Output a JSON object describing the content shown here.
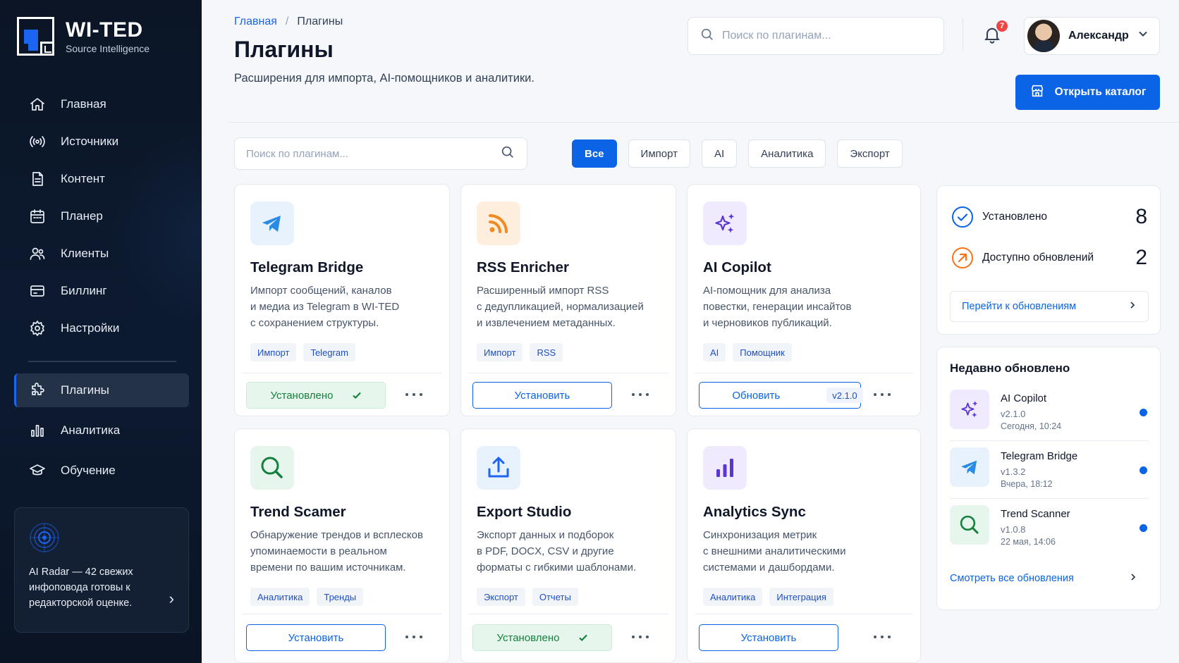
{
  "brand": {
    "title": "WI-TED",
    "subtitle": "Source Intelligence",
    "accent": "#1c64f2"
  },
  "sidebar": {
    "items": [
      {
        "label": "Главная",
        "icon": "home-icon"
      },
      {
        "label": "Источники",
        "icon": "broadcast-icon"
      },
      {
        "label": "Контент",
        "icon": "document-icon"
      },
      {
        "label": "Планер",
        "icon": "calendar-icon"
      },
      {
        "label": "Клиенты",
        "icon": "users-icon"
      },
      {
        "label": "Биллинг",
        "icon": "card-icon"
      },
      {
        "label": "Настройки",
        "icon": "gear-icon"
      }
    ],
    "items2": [
      {
        "label": "Плагины",
        "icon": "puzzle-icon",
        "active": true
      },
      {
        "label": "Аналитика",
        "icon": "bar-chart-icon"
      },
      {
        "label": "Обучение",
        "icon": "graduation-cap-icon"
      }
    ],
    "radar": {
      "text": "AI Radar — 42 свежих инфоповода готовы к редакторской оценке."
    }
  },
  "header": {
    "breadcrumb": {
      "home": "Главная",
      "separator": "/",
      "current": "Плагины"
    },
    "title": "Плагины",
    "subtitle": "Расширения для импорта, AI-помощников и аналитики.",
    "search_placeholder": "Поиск по плагинам...",
    "notifications": "7",
    "user_name": "Александр",
    "catalog_button": "Открыть каталог"
  },
  "filters": {
    "search_placeholder": "Поиск по плагинам...",
    "chips": [
      "Все",
      "Импорт",
      "AI",
      "Аналитика",
      "Экспорт"
    ],
    "active": "Все"
  },
  "plugins": [
    {
      "name": "Telegram Bridge",
      "icon": "telegram-icon",
      "desc": [
        "Импорт сообщений, каналов",
        "и медиа из Telegram в WI-TED",
        "с сохранением структуры."
      ],
      "tags": [
        "Импорт",
        "Telegram"
      ],
      "action": "installed",
      "action_label": "Установлено"
    },
    {
      "name": "RSS Enricher",
      "icon": "rss-icon",
      "desc": [
        "Расширенный импорт RSS",
        "с дедупликацией, нормализацией",
        "и извлечением метаданных."
      ],
      "tags": [
        "Импорт",
        "RSS"
      ],
      "action": "install",
      "action_label": "Установить"
    },
    {
      "name": "AI Copilot",
      "icon": "sparkles-icon",
      "desc": [
        "AI-помощник для анализа",
        "повестки, генерации инсайтов",
        "и черновиков публикаций."
      ],
      "tags": [
        "AI",
        "Помощник"
      ],
      "action": "update",
      "action_label": "Обновить",
      "version": "v2.1.0"
    },
    {
      "name": "Trend Scamer",
      "icon": "search-icon",
      "desc": [
        "Обнаружение трендов и всплесков",
        "упоминаемости в реальном",
        "времени по вашим источникам."
      ],
      "tags": [
        "Аналитика",
        "Тренды"
      ],
      "action": "install",
      "action_label": "Установить"
    },
    {
      "name": "Export Studio",
      "icon": "upload-icon",
      "desc": [
        "Экспорт данных и подборок",
        "в PDF, DOCX, CSV и другие",
        "форматы с гибкими шаблонами."
      ],
      "tags": [
        "Экспорт",
        "Отчеты"
      ],
      "action": "installed",
      "action_label": "Установлено"
    },
    {
      "name": "Analytics Sync",
      "icon": "bar-chart-icon",
      "desc": [
        "Синхронизация метрик",
        "с внешними аналитическими",
        "системами и дашбордами."
      ],
      "tags": [
        "Аналитика",
        "Интеграция"
      ],
      "action": "install",
      "action_label": "Установить"
    }
  ],
  "stats": {
    "installed_label": "Установлено",
    "installed_count": "8",
    "updates_label": "Доступно обновлений",
    "updates_count": "2",
    "link": "Перейти к обновлениям"
  },
  "recent": {
    "title": "Недавно обновлено",
    "items": [
      {
        "name": "AI Copilot",
        "version": "v2.1.0",
        "date": "Сегодня, 10:24",
        "icon": "sparkles-icon"
      },
      {
        "name": "Telegram Bridge",
        "version": "v1.3.2",
        "date": "Вчера, 18:12",
        "icon": "telegram-icon"
      },
      {
        "name": "Trend Scanner",
        "version": "v1.0.8",
        "date": "22 мая, 14:06",
        "icon": "search-icon"
      }
    ],
    "link": "Смотреть все обновления"
  }
}
